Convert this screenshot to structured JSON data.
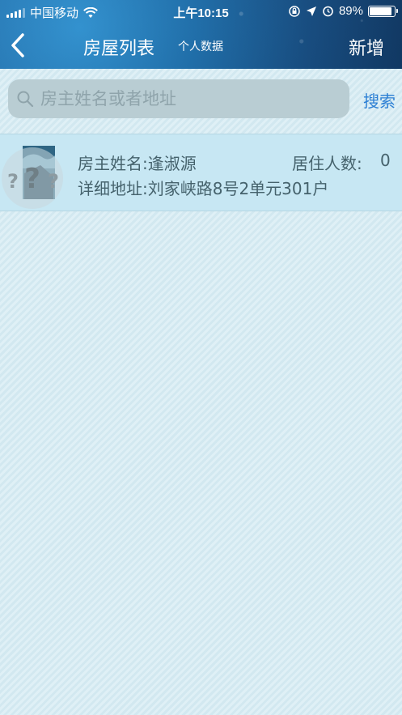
{
  "status_bar": {
    "carrier": "中国移动",
    "time": "上午10:15",
    "battery_percent": "89%",
    "battery_level": 0.89
  },
  "nav": {
    "title": "房屋列表",
    "subtitle": "个人数据",
    "add_label": "新增"
  },
  "search": {
    "placeholder": "房主姓名或者地址",
    "button_label": "搜索"
  },
  "houses": [
    {
      "owner": "房主姓名:逢淑源",
      "resident_label": "居住人数:",
      "resident_count": "0",
      "address": "详细地址:刘家峡路8号2单元301户"
    }
  ],
  "colors": {
    "header": "#1b6fae",
    "accent": "#2c7fd4",
    "row_bg": "#c7e7f3",
    "row_text": "#45626c"
  },
  "icons": [
    "signal-icon",
    "wifi-icon",
    "location-icon",
    "alarm-icon",
    "lock-rotation-icon",
    "battery-icon",
    "back-icon",
    "search-icon"
  ]
}
